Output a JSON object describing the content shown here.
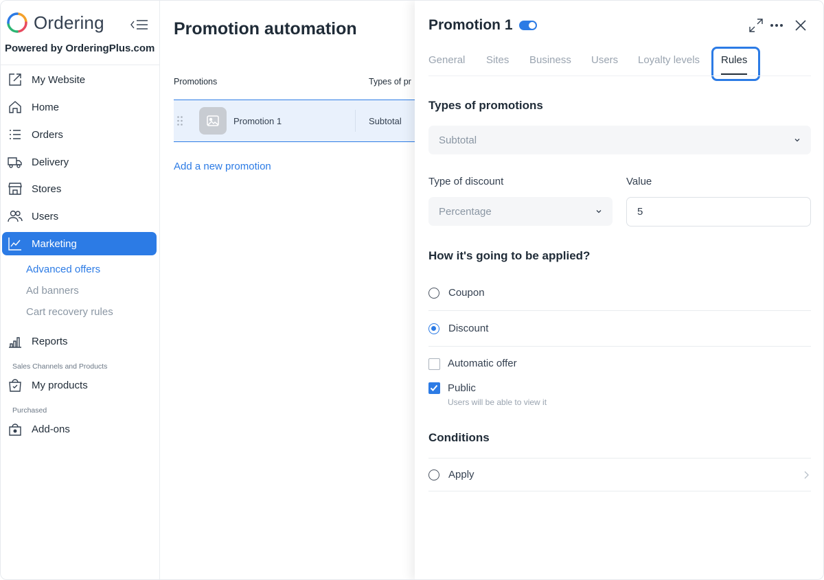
{
  "brand": {
    "name": "Ordering",
    "powered_by": "Powered by OrderingPlus.com"
  },
  "sidebar": {
    "items": [
      {
        "label": "My Website",
        "icon": "external-link-icon"
      },
      {
        "label": "Home",
        "icon": "home-icon"
      },
      {
        "label": "Orders",
        "icon": "list-icon"
      },
      {
        "label": "Delivery",
        "icon": "truck-icon"
      },
      {
        "label": "Stores",
        "icon": "store-icon"
      },
      {
        "label": "Users",
        "icon": "users-icon"
      },
      {
        "label": "Marketing",
        "icon": "chart-line-icon",
        "active": true
      }
    ],
    "marketing_sub": [
      {
        "label": "Advanced offers",
        "active": true
      },
      {
        "label": "Ad banners"
      },
      {
        "label": "Cart recovery rules"
      }
    ],
    "reports": "Reports",
    "section_sales": "Sales Channels and Products",
    "my_products": "My products",
    "section_purchased": "Purchased",
    "addons": "Add-ons"
  },
  "main": {
    "title": "Promotion automation",
    "columns": {
      "promotions": "Promotions",
      "types": "Types of pr"
    },
    "rows": [
      {
        "name": "Promotion 1",
        "type": "Subtotal"
      }
    ],
    "add_link": "Add a new promotion"
  },
  "panel": {
    "title": "Promotion 1",
    "enabled": true,
    "tabs": [
      "General",
      "Sites",
      "Business",
      "Users",
      "Loyalty levels",
      "Rules"
    ],
    "active_tab": "Rules",
    "types_title": "Types of promotions",
    "types_value": "Subtotal",
    "discount_label": "Type of discount",
    "discount_value": "Percentage",
    "value_label": "Value",
    "value": "5",
    "applied_title": "How it's going to be applied?",
    "options": [
      {
        "label": "Coupon",
        "selected": false
      },
      {
        "label": "Discount",
        "selected": true
      }
    ],
    "automatic_offer": "Automatic offer",
    "public": "Public",
    "public_hint": "Users will be able to view it",
    "conditions_title": "Conditions",
    "apply": "Apply"
  },
  "colors": {
    "accent": "#2c7be5",
    "text": "#1f2b37",
    "muted": "#8a96a3"
  }
}
